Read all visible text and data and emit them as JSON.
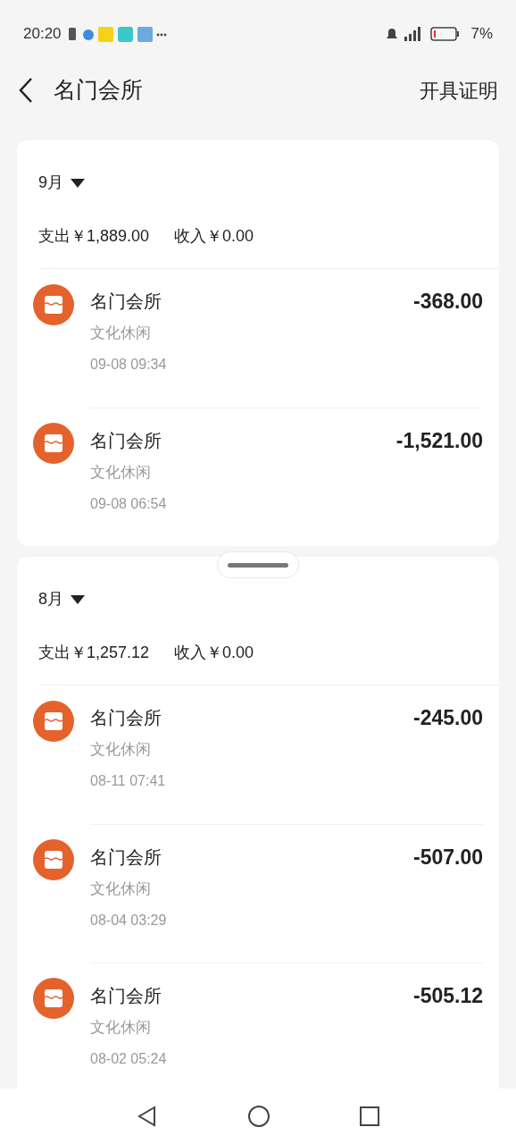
{
  "status_bar": {
    "time": "20:20",
    "battery": "7%"
  },
  "header": {
    "title": "名门会所",
    "action": "开具证明"
  },
  "months": [
    {
      "label": "9月",
      "summary": "支出￥1,889.00",
      "income": "收入￥0.00",
      "handle": false,
      "transactions": [
        {
          "merchant": "名门会所",
          "category": "文化休闲",
          "time": "09-08 09:34",
          "amount": "-368.00"
        },
        {
          "merchant": "名门会所",
          "category": "文化休闲",
          "time": "09-08 06:54",
          "amount": "-1,521.00"
        }
      ]
    },
    {
      "label": "8月",
      "summary": "支出￥1,257.12",
      "income": "收入￥0.00",
      "handle": true,
      "transactions": [
        {
          "merchant": "名门会所",
          "category": "文化休闲",
          "time": "08-11 07:41",
          "amount": "-245.00"
        },
        {
          "merchant": "名门会所",
          "category": "文化休闲",
          "time": "08-04 03:29",
          "amount": "-507.00"
        },
        {
          "merchant": "名门会所",
          "category": "文化休闲",
          "time": "08-02 05:24",
          "amount": "-505.12"
        }
      ]
    }
  ]
}
